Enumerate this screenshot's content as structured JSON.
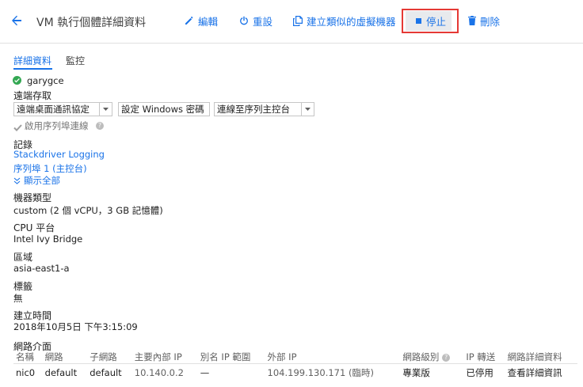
{
  "header": {
    "back_icon": "arrow-back-icon",
    "title": "VM 執行個體詳細資料",
    "actions": {
      "edit": "編輯",
      "reset": "重設",
      "clone": "建立類似的虛擬機器",
      "stop": "停止",
      "delete": "刪除"
    }
  },
  "tabs": {
    "details": "詳細資料",
    "monitoring": "監控"
  },
  "instance": {
    "name": "garygce",
    "status_icon": "check-circle-icon",
    "status_color": "#34a853"
  },
  "remote_access": {
    "label": "遠端存取",
    "rdp_dropdown": "遠端桌面通訊協定",
    "windows_password_button": "設定 Windows 密碼",
    "serial_console_button": "連線至序列主控台",
    "serial_checkbox_label": "啟用序列埠連線",
    "serial_checkbox_checked": true
  },
  "logs": {
    "label": "記錄",
    "stackdriver_link": "Stackdriver Logging",
    "serial_port_link": "序列埠 1 (主控台)",
    "show_all": "顯示全部"
  },
  "machine_type": {
    "label": "機器類型",
    "value": "custom (2 個 vCPU，3 GB 記憶體)"
  },
  "cpu_platform": {
    "label": "CPU 平台",
    "value": "Intel Ivy Bridge"
  },
  "zone": {
    "label": "區域",
    "value": "asia-east1-a"
  },
  "labels": {
    "label": "標籤",
    "value": "無"
  },
  "created": {
    "label": "建立時間",
    "value": "2018年10月5日 下午3:15:09"
  },
  "network_interfaces": {
    "label": "網路介面",
    "columns": [
      "名稱",
      "網路",
      "子網路",
      "主要內部 IP",
      "別名 IP 範圍",
      "外部 IP",
      "網路級別",
      "IP 轉送",
      "網路詳細資料"
    ],
    "rows": [
      {
        "name": "nic0",
        "network": "default",
        "subnetwork": "default",
        "internal_ip": "10.140.0.2",
        "alias_ip": "—",
        "external_ip": "104.199.130.171 (臨時)",
        "tier": "專業版",
        "ip_forwarding": "已停用",
        "details": "查看詳細資訊"
      }
    ]
  },
  "colors": {
    "accent": "#1a73e8",
    "stop_highlight": "#e53935",
    "ok": "#34a853"
  }
}
